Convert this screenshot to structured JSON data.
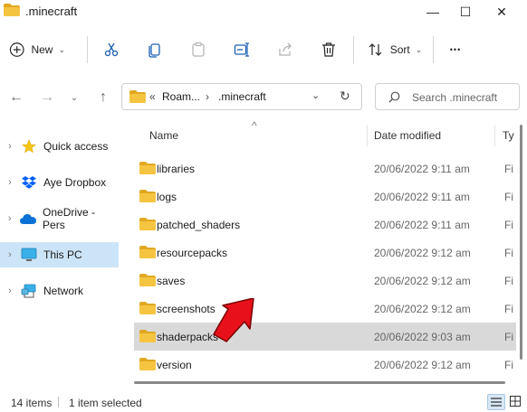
{
  "window": {
    "title": ".minecraft",
    "controls": {
      "minimize": "—",
      "maximize": "☐",
      "close": "✕"
    }
  },
  "toolbar": {
    "new_label": "New",
    "sort_label": "Sort",
    "more_label": "•••"
  },
  "address": {
    "overflow": "«",
    "crumbs": [
      "Roam...",
      ".minecraft"
    ],
    "separator": "›",
    "search_placeholder": "Search .minecraft"
  },
  "sidebar": {
    "items": [
      {
        "label": "Quick access",
        "icon": "star-icon"
      },
      {
        "label": "Aye Dropbox",
        "icon": "dropbox-icon"
      },
      {
        "label": "OneDrive - Pers",
        "icon": "onedrive-cloud-icon"
      },
      {
        "label": "This PC",
        "icon": "monitor-icon",
        "selected": true
      },
      {
        "label": "Network",
        "icon": "network-icon"
      }
    ]
  },
  "columns": {
    "name": "Name",
    "date": "Date modified",
    "type": "Ty"
  },
  "files": [
    {
      "name": "libraries",
      "date": "20/06/2022 9:11 am",
      "type": "Fi"
    },
    {
      "name": "logs",
      "date": "20/06/2022 9:11 am",
      "type": "Fi"
    },
    {
      "name": "patched_shaders",
      "date": "20/06/2022 9:11 am",
      "type": "Fi"
    },
    {
      "name": "resourcepacks",
      "date": "20/06/2022 9:12 am",
      "type": "Fi"
    },
    {
      "name": "saves",
      "date": "20/06/2022 9:12 am",
      "type": "Fi"
    },
    {
      "name": "screenshots",
      "date": "20/06/2022 9:12 am",
      "type": "Fi"
    },
    {
      "name": "shaderpacks",
      "date": "20/06/2022 9:03 am",
      "type": "Fi",
      "selected": true
    },
    {
      "name": "version",
      "date": "20/06/2022 9:12 am",
      "type": "Fi"
    }
  ],
  "status": {
    "count": "14 items",
    "selection": "1 item selected"
  },
  "colors": {
    "folder": "#f5c542",
    "folder_dark": "#e0a820",
    "selection_nav": "#cce4f7",
    "selection_row": "#d9d9d9",
    "annotation_arrow": "#e8111b"
  }
}
